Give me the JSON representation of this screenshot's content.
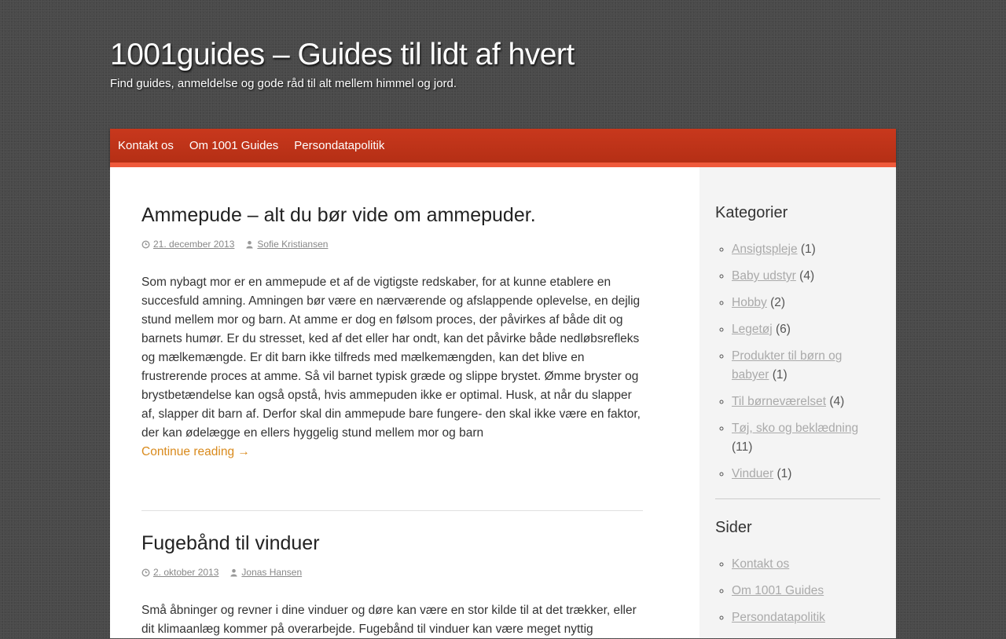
{
  "site": {
    "title": "1001guides – Guides til lidt af hvert",
    "description": "Find guides, anmeldelse og gode råd til alt mellem himmel og jord."
  },
  "nav": {
    "items": [
      {
        "label": "Kontakt os"
      },
      {
        "label": "Om 1001 Guides"
      },
      {
        "label": "Persondatapolitik"
      }
    ]
  },
  "posts": [
    {
      "title": "Ammepude – alt du bør vide om ammepuder.",
      "date": "21. december 2013",
      "author": "Sofie Kristiansen",
      "excerpt": "Som nybagt mor er en ammepude et af de vigtigste redskaber, for at kunne etablere en succesfuld amning. Amningen bør være en nærværende og afslappende oplevelse, en dejlig stund mellem mor og barn. At amme er dog en følsom proces, der påvirkes af både dit og barnets humør. Er du stresset, ked af det eller har ondt, kan det påvirke både nedløbsrefleks og mælkemængde. Er dit barn ikke tilfreds med mælkemængden, kan det blive en frustrerende proces at amme. Så vil barnet typisk græde og slippe brystet. Ømme bryster og brystbetændelse kan også opstå, hvis ammepuden ikke er optimal.  Husk, at når du slapper af, slapper dit barn af. Derfor skal din ammepude bare fungere- den skal ikke være en faktor, der kan ødelægge en ellers hyggelig stund mellem mor og barn",
      "continue_label": "Continue reading →"
    },
    {
      "title": "Fugebånd til vinduer",
      "date": "2. oktober 2013",
      "author": "Jonas Hansen",
      "excerpt": "Små åbninger og revner i dine vinduer og døre kan være en stor kilde til at det trækker, eller dit klimaanlæg kommer på overarbejde. Fugebånd til vinduer kan være meget nyttig"
    }
  ],
  "sidebar": {
    "categories": {
      "heading": "Kategorier",
      "items": [
        {
          "label": "Ansigtspleje",
          "count": "(1)"
        },
        {
          "label": "Baby udstyr",
          "count": "(4)"
        },
        {
          "label": "Hobby",
          "count": "(2)"
        },
        {
          "label": "Legetøj",
          "count": "(6)"
        },
        {
          "label": "Produkter til børn og babyer",
          "count": "(1)"
        },
        {
          "label": "Til børneværelset",
          "count": "(4)"
        },
        {
          "label": "Tøj, sko og beklædning",
          "count": "(11)"
        },
        {
          "label": "Vinduer",
          "count": "(1)"
        }
      ]
    },
    "pages": {
      "heading": "Sider",
      "items": [
        {
          "label": "Kontakt os"
        },
        {
          "label": "Om 1001 Guides"
        },
        {
          "label": "Persondatapolitik"
        }
      ]
    }
  },
  "colors": {
    "nav_background": "#c8381d",
    "nav_accent": "#ef5a3b",
    "link_accent": "#d98a1c"
  }
}
